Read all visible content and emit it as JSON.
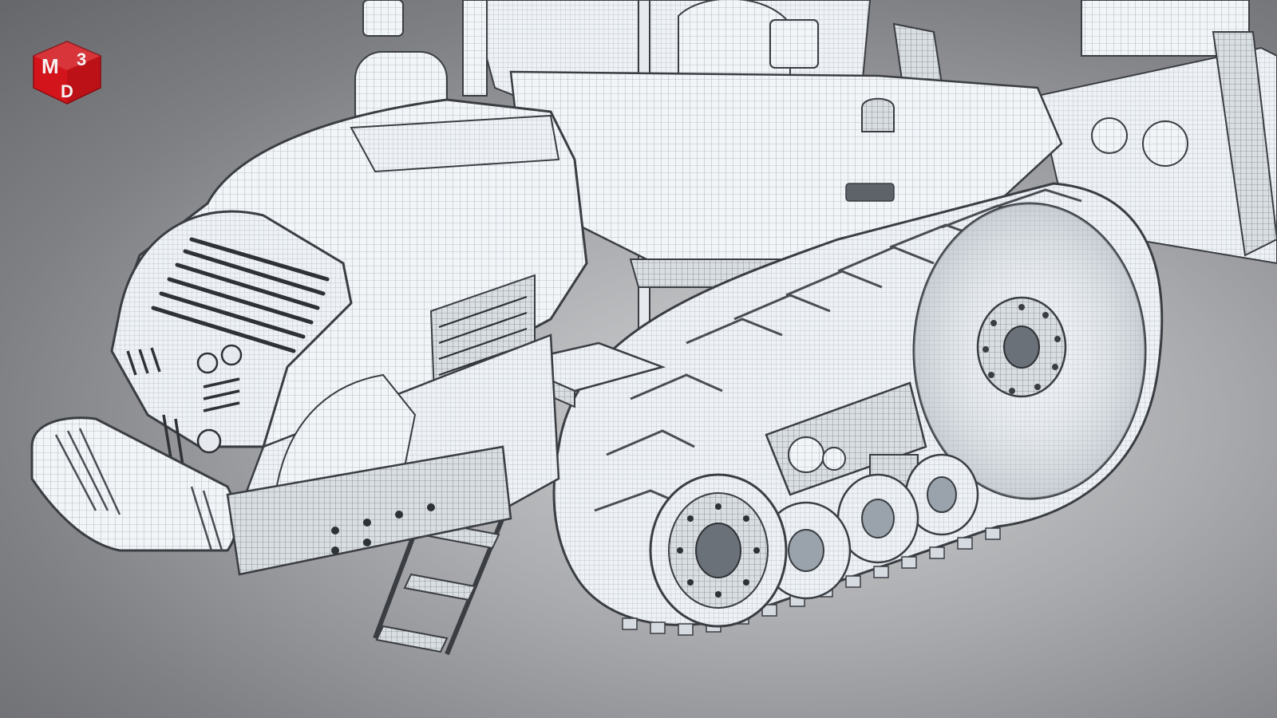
{
  "logo": {
    "letters": [
      "M",
      "3",
      "D"
    ],
    "colors": {
      "face": "#d4141b",
      "light": "#f4f4f4",
      "shadow": "#8c0b10"
    }
  },
  "render": {
    "subject": "tracked-tractor-wireframe",
    "colors": {
      "background_center": "#d2d3d5",
      "background_edge": "#66676b",
      "model_fill": "#f2f5f8",
      "wire_line": "#3a3d42",
      "accent_blue": "#dfeaf3"
    }
  }
}
